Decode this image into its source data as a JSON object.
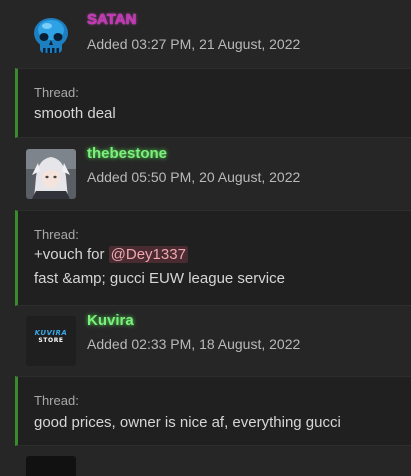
{
  "entries": [
    {
      "username": "SATAN",
      "date": "Added 03:27 PM, 21 August, 2022",
      "avatar_icon": "blue-skull-icon",
      "thread_label": "Thread:",
      "thread_lines": [
        "smooth deal"
      ]
    },
    {
      "username": "thebestone",
      "date": "Added 05:50 PM, 20 August, 2022",
      "avatar_icon": "anime-character-avatar",
      "thread_label": "Thread:",
      "thread_line1_prefix": "+vouch for ",
      "mention": "@Dey1337",
      "thread_line2": "fast &amp; gucci EUW league service"
    },
    {
      "username": "Kuvira",
      "date": "Added 02:33 PM, 18 August, 2022",
      "avatar_icon": "kuvira-store-logo",
      "avatar_logo_line1": "KUVIRA",
      "avatar_logo_line2": "STORE",
      "thread_label": "Thread:",
      "thread_lines": [
        "good prices, owner is nice af, everything gucci"
      ]
    }
  ],
  "colors": {
    "background": "#262626",
    "thread_background": "#202020",
    "thread_border": "#3a8a2e",
    "satan_name": "#c832b8",
    "green_name": "#7cf07c",
    "mention_bg": "#4a2b31",
    "mention_text": "#f0a7b0"
  }
}
